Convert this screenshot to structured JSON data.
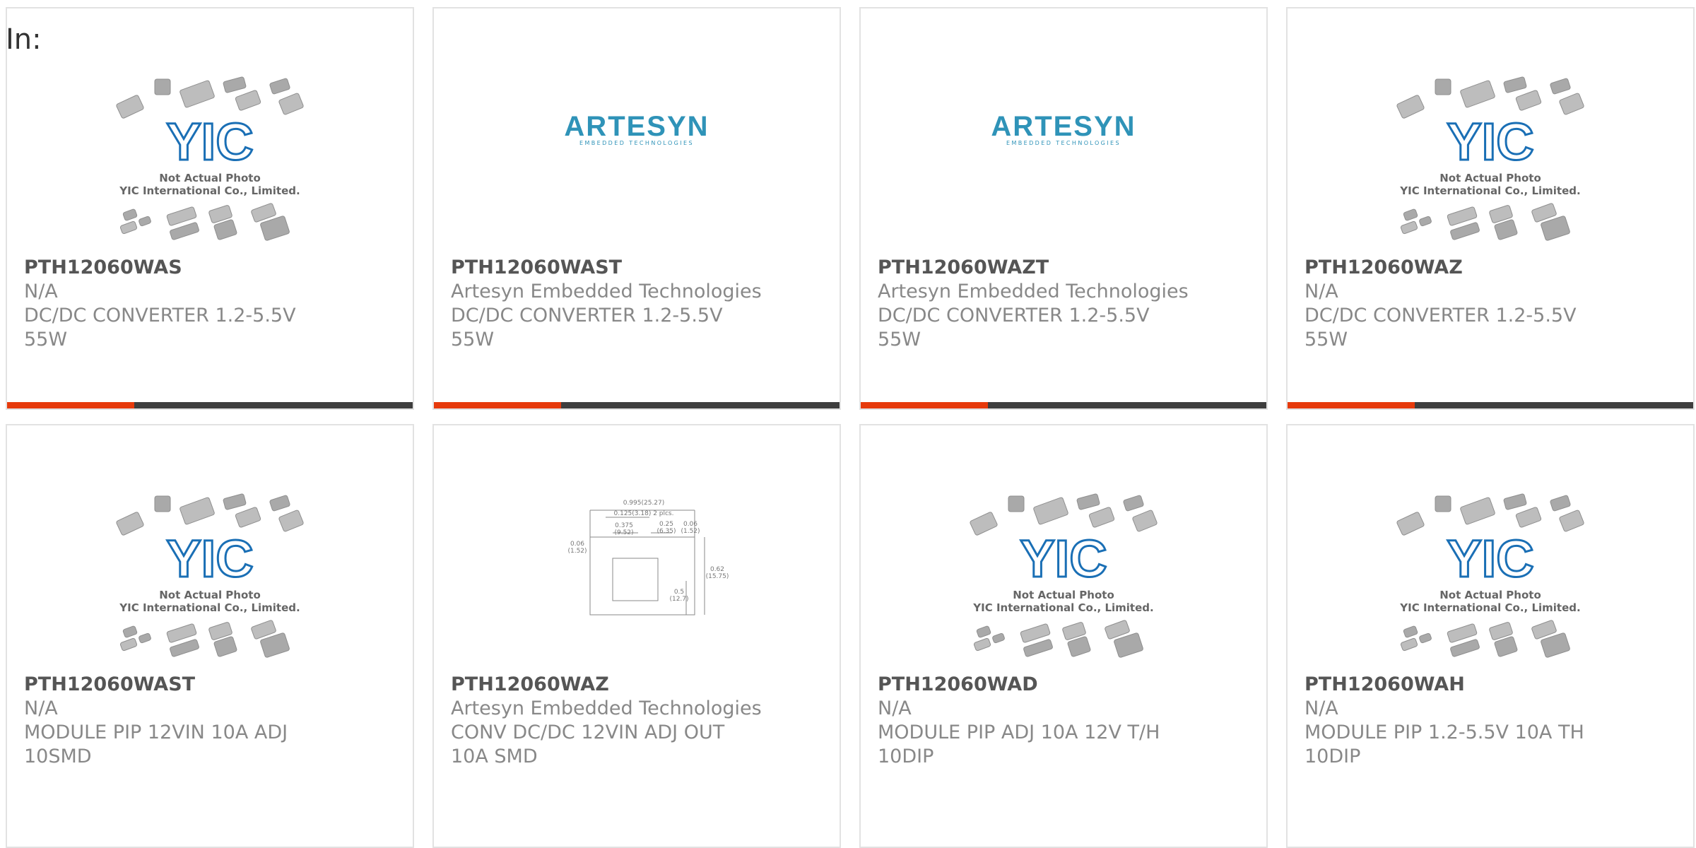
{
  "page_label": "In:",
  "colors": {
    "accent": "#e63a0c",
    "bar": "#3e3e3e",
    "brand_blue": "#1a6fb5",
    "artesyn_blue": "#2f93b8"
  },
  "placeholder_images": {
    "yic": {
      "line1": "Not Actual Photo",
      "line2": "YIC International Co., Limited.",
      "brand": "YIC"
    },
    "artesyn": {
      "brand": "ARTESYN",
      "tagline": "EMBEDDED TECHNOLOGIES"
    },
    "drawing": {
      "labels": [
        "0.995(25.27)",
        "0.125(3.18) 2 plcs.",
        "0.375",
        "(9.52)",
        "0.25",
        "(6.35)",
        "0.06",
        "(1.52)",
        "0.06",
        "(1.52)",
        "0.5",
        "(12.7)",
        "0.62",
        "(15.75)"
      ]
    }
  },
  "products": [
    {
      "part": "PTH12060WAS",
      "mfr": "N/A",
      "desc": "DC/DC CONVERTER 1.2-5.5V\n55W",
      "image": "yic"
    },
    {
      "part": "PTH12060WAST",
      "mfr": "Artesyn Embedded Technologies",
      "desc": "DC/DC CONVERTER 1.2-5.5V\n55W",
      "image": "artesyn"
    },
    {
      "part": "PTH12060WAZT",
      "mfr": "Artesyn Embedded Technologies",
      "desc": "DC/DC CONVERTER 1.2-5.5V\n55W",
      "image": "artesyn"
    },
    {
      "part": "PTH12060WAZ",
      "mfr": "N/A",
      "desc": "DC/DC CONVERTER 1.2-5.5V\n55W",
      "image": "yic"
    },
    {
      "part": "PTH12060WAST",
      "mfr": "N/A",
      "desc": "MODULE PIP 12VIN 10A ADJ\n10SMD",
      "image": "yic"
    },
    {
      "part": "PTH12060WAZ",
      "mfr": "Artesyn Embedded Technologies",
      "desc": "CONV DC/DC 12VIN ADJ OUT\n10A SMD",
      "image": "drawing"
    },
    {
      "part": "PTH12060WAD",
      "mfr": "N/A",
      "desc": "MODULE PIP ADJ 10A 12V T/H\n10DIP",
      "image": "yic"
    },
    {
      "part": "PTH12060WAH",
      "mfr": "N/A",
      "desc": "MODULE PIP 1.2-5.5V 10A TH\n10DIP",
      "image": "yic"
    }
  ]
}
